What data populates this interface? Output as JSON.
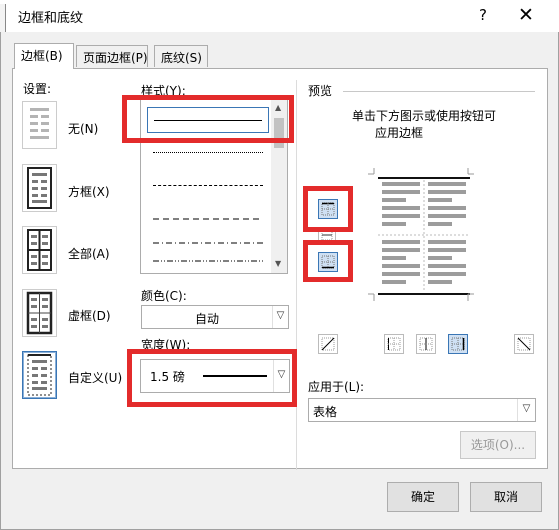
{
  "window": {
    "title": "边框和底纹",
    "help": "?",
    "close": "✕"
  },
  "tabs": [
    {
      "label": "边框(B)"
    },
    {
      "label": "页面边框(P)"
    },
    {
      "label": "底纹(S)"
    }
  ],
  "settings": {
    "label": "设置:",
    "items": [
      {
        "label": "无(N)",
        "icon": "no-border-icon"
      },
      {
        "label": "方框(X)",
        "icon": "box-border-icon"
      },
      {
        "label": "全部(A)",
        "icon": "all-borders-icon"
      },
      {
        "label": "虚框(D)",
        "icon": "grid-border-icon"
      },
      {
        "label": "自定义(U)",
        "icon": "custom-border-icon"
      }
    ]
  },
  "style": {
    "label": "样式(Y):",
    "options": [
      "solid",
      "dotted",
      "dashed",
      "long-dash",
      "dash-dot",
      "dash-dot-dot"
    ]
  },
  "color": {
    "label": "颜色(C):",
    "value": "自动"
  },
  "width": {
    "label": "宽度(W):",
    "value": "1.5 磅"
  },
  "preview": {
    "label": "预览",
    "hint_line1": "单击下方图示或使用按钮可",
    "hint_line2": "应用边框"
  },
  "apply_to": {
    "label": "应用于(L):",
    "value": "表格"
  },
  "buttons": {
    "options": "选项(O)...",
    "ok": "确定",
    "cancel": "取消"
  },
  "colors": {
    "accent": "#3a76b5",
    "highlight": "#e32b2b",
    "dialog_bg": "#f0f0f0"
  }
}
